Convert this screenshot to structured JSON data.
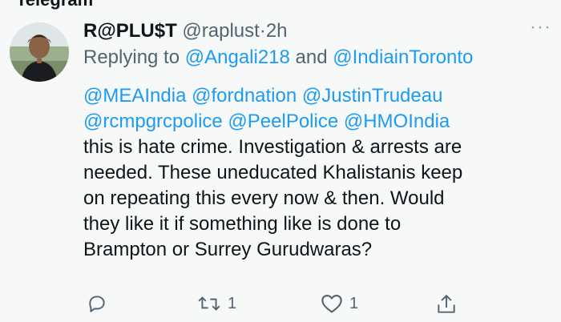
{
  "watermark": "Telegram",
  "tweet": {
    "display_name": "R@PLU$T",
    "handle": "@raplust",
    "separator": "·",
    "time": "2h",
    "more_label": "···",
    "replying_prefix": "Replying to",
    "replying_to_1": "@Angali218",
    "replying_and": "and",
    "replying_to_2": "@IndiainToronto",
    "mentions": [
      "@MEAIndia",
      "@fordnation",
      "@JustinTrudeau",
      "@rcmpgrcpolice",
      "@PeelPolice",
      "@HMOIndia"
    ],
    "text_lines": [
      "this is hate crime. Investigation & arrests are",
      "needed. These uneducated Khalistanis keep",
      "on repeating this every now & then. Would",
      "they like it if something like is done to",
      "Brampton or Surrey Gurudwaras?"
    ]
  },
  "actions": {
    "reply_count": "",
    "retweet_count": "1",
    "like_count": "1"
  },
  "colors": {
    "link": "#1d9bf0",
    "muted": "#536471",
    "text": "#0f1419",
    "background": "#f7f9f9"
  },
  "icons": [
    "reply-icon",
    "retweet-icon",
    "like-icon",
    "share-icon",
    "more-icon"
  ]
}
